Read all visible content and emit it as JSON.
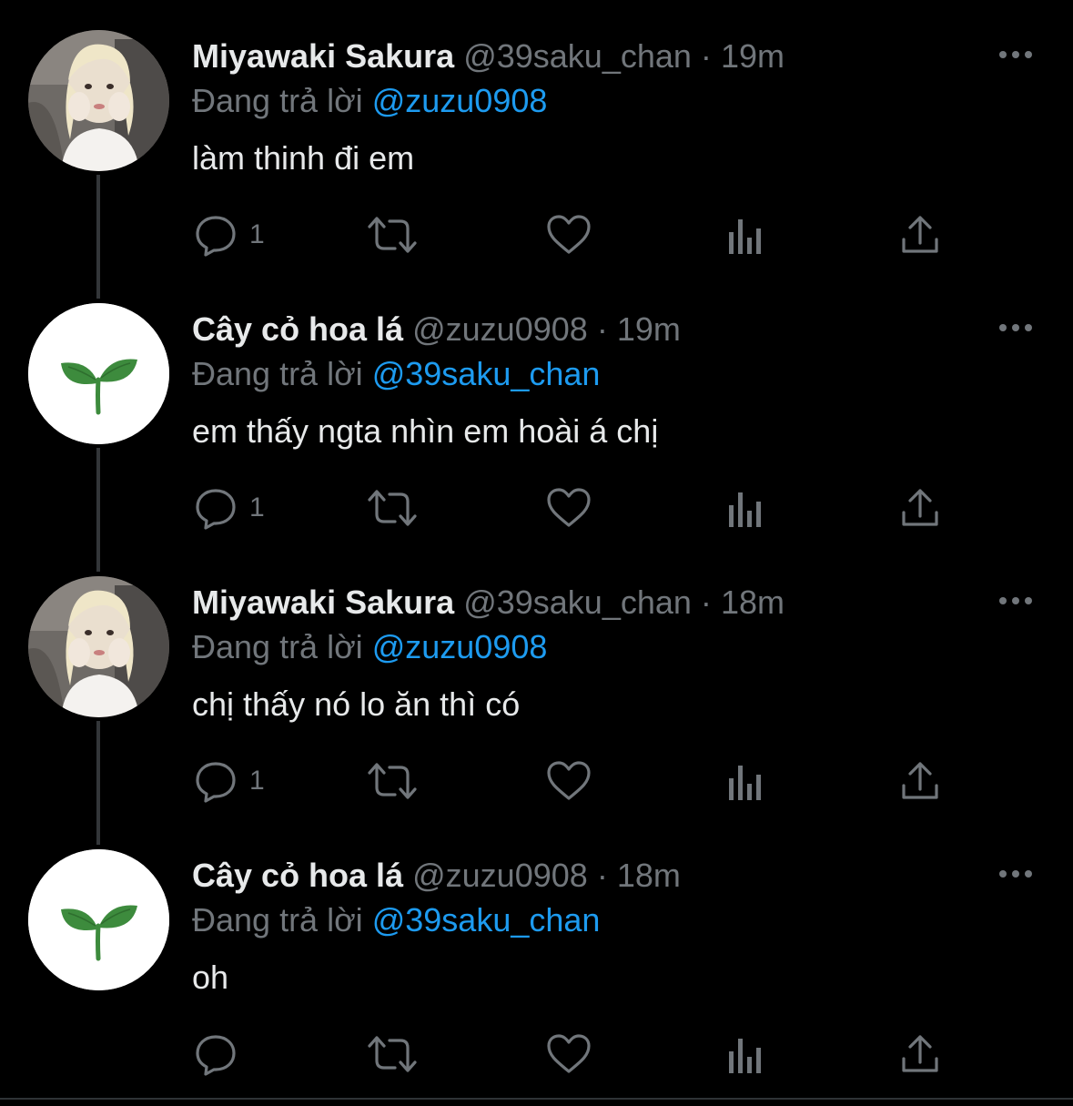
{
  "colors": {
    "background": "#000000",
    "text_primary": "#e7e9ea",
    "text_secondary": "#71767b",
    "mention": "#1d9bf0",
    "thread_line": "#333639",
    "sprout_green": "#3d8b3d"
  },
  "tweets": [
    {
      "avatar_icon": "user-photo-avatar",
      "display_name": "Miyawaki Sakura",
      "handle": "@39saku_chan",
      "separator": "·",
      "time": "19m",
      "reply_prefix": "Đang trả lời",
      "reply_to": "@zuzu0908",
      "text": "làm thinh đi em",
      "reply_count": "1"
    },
    {
      "avatar_icon": "sprout-avatar",
      "display_name": "Cây cỏ hoa lá",
      "handle": "@zuzu0908",
      "separator": "·",
      "time": "19m",
      "reply_prefix": "Đang trả lời",
      "reply_to": "@39saku_chan",
      "text": "em thấy ngta nhìn em hoài á chị",
      "reply_count": "1"
    },
    {
      "avatar_icon": "user-photo-avatar",
      "display_name": "Miyawaki Sakura",
      "handle": "@39saku_chan",
      "separator": "·",
      "time": "18m",
      "reply_prefix": "Đang trả lời",
      "reply_to": "@zuzu0908",
      "text": "chị thấy nó lo ăn thì có",
      "reply_count": "1"
    },
    {
      "avatar_icon": "sprout-avatar",
      "display_name": "Cây cỏ hoa lá",
      "handle": "@zuzu0908",
      "separator": "·",
      "time": "18m",
      "reply_prefix": "Đang trả lời",
      "reply_to": "@39saku_chan",
      "text": "oh",
      "reply_count": ""
    }
  ],
  "action_icons": [
    "reply-icon",
    "retweet-icon",
    "like-icon",
    "views-icon",
    "share-icon"
  ]
}
